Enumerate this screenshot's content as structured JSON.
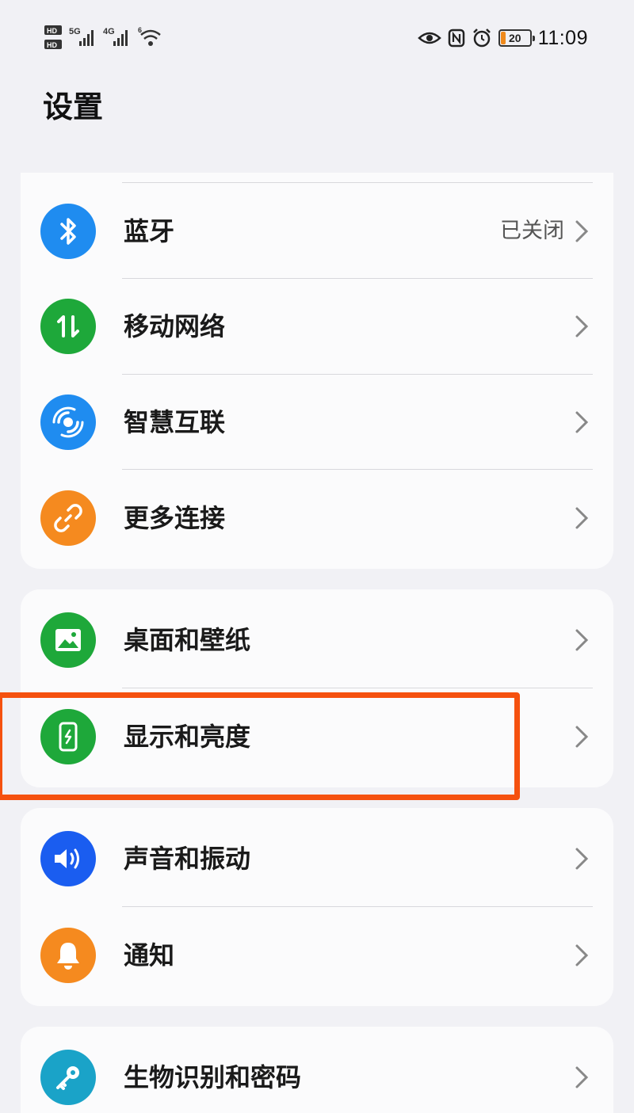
{
  "status_bar": {
    "time": "11:09",
    "battery_level": "20",
    "network_labels": [
      "HD",
      "HD",
      "5G",
      "4G",
      "6"
    ]
  },
  "page": {
    "title": "设置"
  },
  "groups": [
    {
      "items": [
        {
          "label": "蓝牙",
          "value": "已关闭",
          "icon": "bluetooth-icon",
          "color": "#1f8cf0"
        },
        {
          "label": "移动网络",
          "icon": "mobile-data-icon",
          "color": "#1ea83a"
        },
        {
          "label": "智慧互联",
          "icon": "smart-connect-icon",
          "color": "#1f8cf0"
        },
        {
          "label": "更多连接",
          "icon": "link-icon",
          "color": "#f58a1f"
        }
      ]
    },
    {
      "items": [
        {
          "label": "桌面和壁纸",
          "icon": "wallpaper-icon",
          "color": "#1ea83a"
        },
        {
          "label": "显示和亮度",
          "icon": "display-icon",
          "color": "#1ea83a"
        }
      ]
    },
    {
      "items": [
        {
          "label": "声音和振动",
          "icon": "sound-icon",
          "color": "#1a5df0"
        },
        {
          "label": "通知",
          "icon": "bell-icon",
          "color": "#f58a1f"
        }
      ]
    },
    {
      "items": [
        {
          "label": "生物识别和密码",
          "icon": "key-icon",
          "color": "#1aa3c8"
        }
      ]
    }
  ],
  "highlight_color": "#f5510f"
}
